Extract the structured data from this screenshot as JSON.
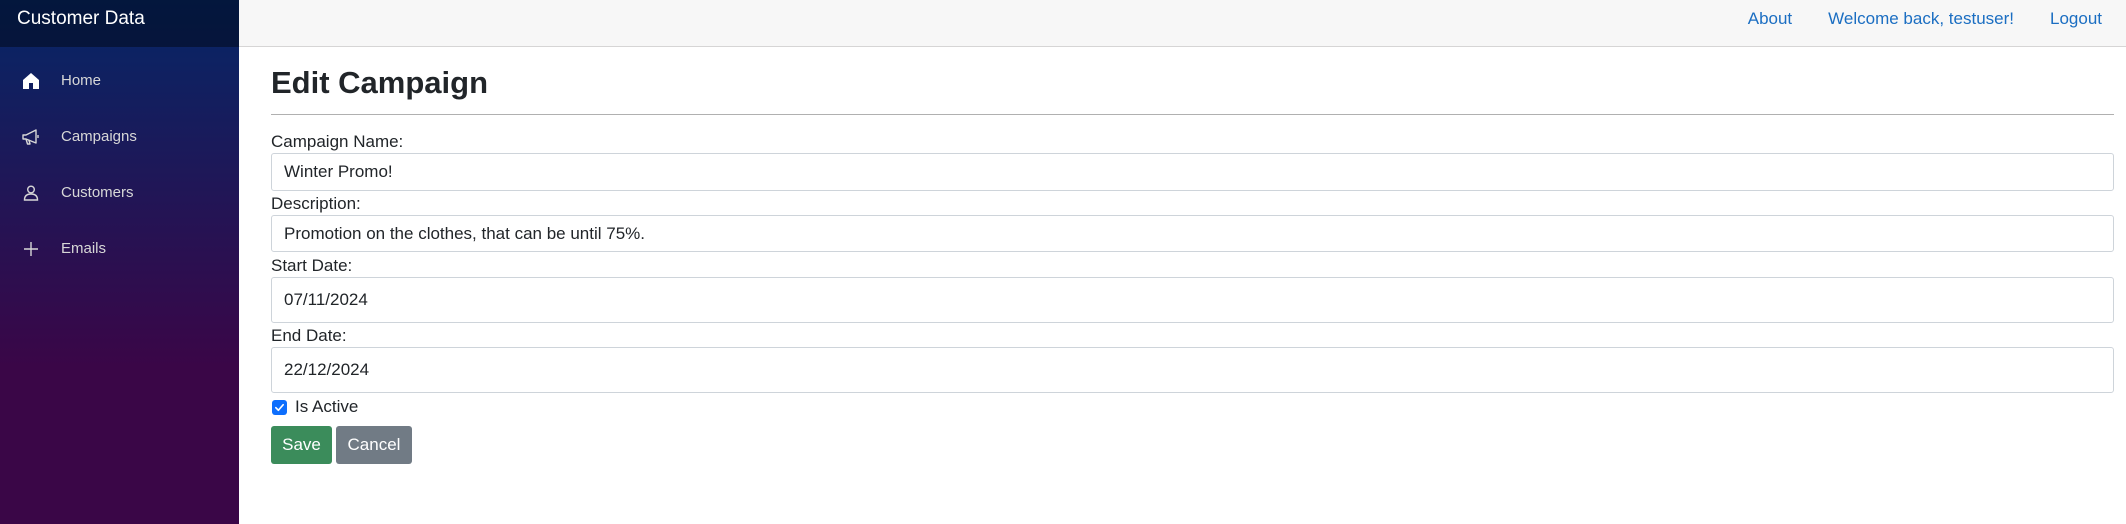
{
  "app": {
    "brand": "Customer Data"
  },
  "sidebar": {
    "items": [
      {
        "label": "Home",
        "icon": "home-icon"
      },
      {
        "label": "Campaigns",
        "icon": "megaphone-icon"
      },
      {
        "label": "Customers",
        "icon": "person-icon"
      },
      {
        "label": "Emails",
        "icon": "plus-icon"
      }
    ]
  },
  "topbar": {
    "about": "About",
    "welcome": "Welcome back, testuser!",
    "logout": "Logout"
  },
  "page": {
    "title": "Edit Campaign"
  },
  "form": {
    "name_label": "Campaign Name:",
    "name_value": "Winter Promo!",
    "description_label": "Description:",
    "description_value": "Promotion on the clothes, that can be until 75%.",
    "start_label": "Start Date:",
    "start_value": "07/11/2024",
    "end_label": "End Date:",
    "end_value": "22/12/2024",
    "active_label": "Is Active",
    "active_checked": true,
    "save_label": "Save",
    "cancel_label": "Cancel"
  },
  "colors": {
    "link": "#1b6ec2",
    "save": "#3b8c5b",
    "cancel": "#717b85",
    "checkbox": "#0d6efd"
  }
}
